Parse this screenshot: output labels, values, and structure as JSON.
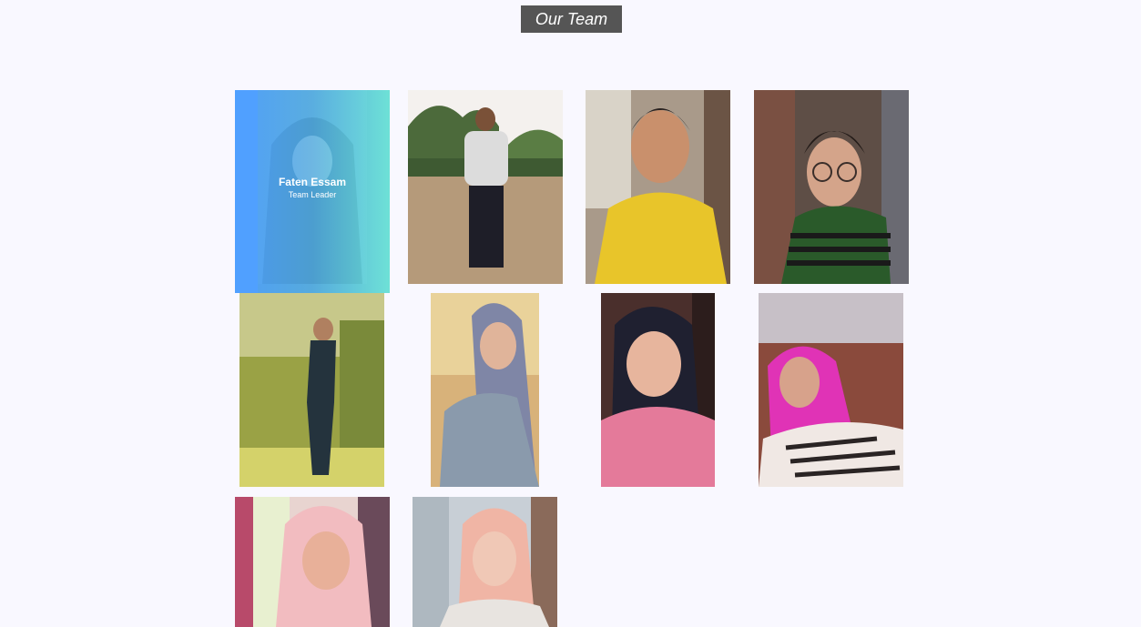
{
  "page": {
    "title": "Our Team"
  },
  "team": [
    {
      "name": "Faten Essam",
      "role": "Team Leader",
      "highlighted": true
    },
    {
      "name": "",
      "role": "",
      "highlighted": false
    },
    {
      "name": "",
      "role": "",
      "highlighted": false
    },
    {
      "name": "",
      "role": "",
      "highlighted": false
    },
    {
      "name": "",
      "role": "",
      "highlighted": false
    },
    {
      "name": "",
      "role": "",
      "highlighted": false
    },
    {
      "name": "",
      "role": "",
      "highlighted": false
    },
    {
      "name": "",
      "role": "",
      "highlighted": false
    },
    {
      "name": "",
      "role": "",
      "highlighted": false
    },
    {
      "name": "",
      "role": "",
      "highlighted": false
    }
  ],
  "colors": {
    "background": "#f9f8ff",
    "title_bg": "#555555",
    "overlay_start": "#4da0ff",
    "overlay_end": "#6ef0e1"
  }
}
